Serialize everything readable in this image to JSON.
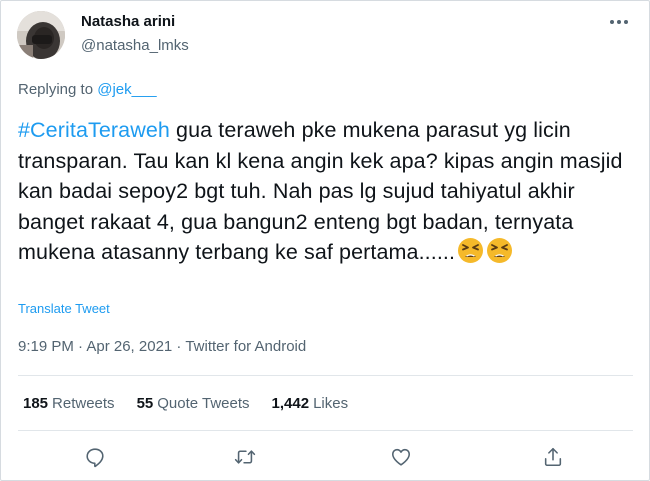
{
  "author": {
    "name": "Natasha arini",
    "handle": "@natasha_lmks",
    "avatar_icon": "profile-photo"
  },
  "reply": {
    "prefix": "Replying to",
    "mention": "@jek___"
  },
  "tweet": {
    "hashtag": "#CeritaTeraweh",
    "body": " gua teraweh pke mukena parasut yg licin transparan. Tau kan kl kena angin kek apa? kipas angin masjid kan badai sepoy2 bgt tuh. Nah pas lg sujud tahiyatul akhir banget rakaat 4, gua bangun2 enteng bgt badan, ternyata mukena atasanny terbang ke saf pertama......",
    "emoji": [
      "tired-face-emoji",
      "tired-face-emoji"
    ]
  },
  "translate_label": "Translate Tweet",
  "meta": "9:19 PM · Apr 26, 2021 · Twitter for Android",
  "stats": {
    "retweets_count": "185",
    "retweets_label": "Retweets",
    "quotes_count": "55",
    "quotes_label": "Quote Tweets",
    "likes_count": "1,442",
    "likes_label": "Likes"
  },
  "actions": [
    "reply-icon",
    "retweet-icon",
    "like-icon",
    "share-icon"
  ],
  "colors": {
    "text": "#0f1419",
    "secondary": "#536471",
    "link": "#1d9bf0",
    "divider": "#e1e6ea",
    "emoji": "#f5b92a"
  }
}
